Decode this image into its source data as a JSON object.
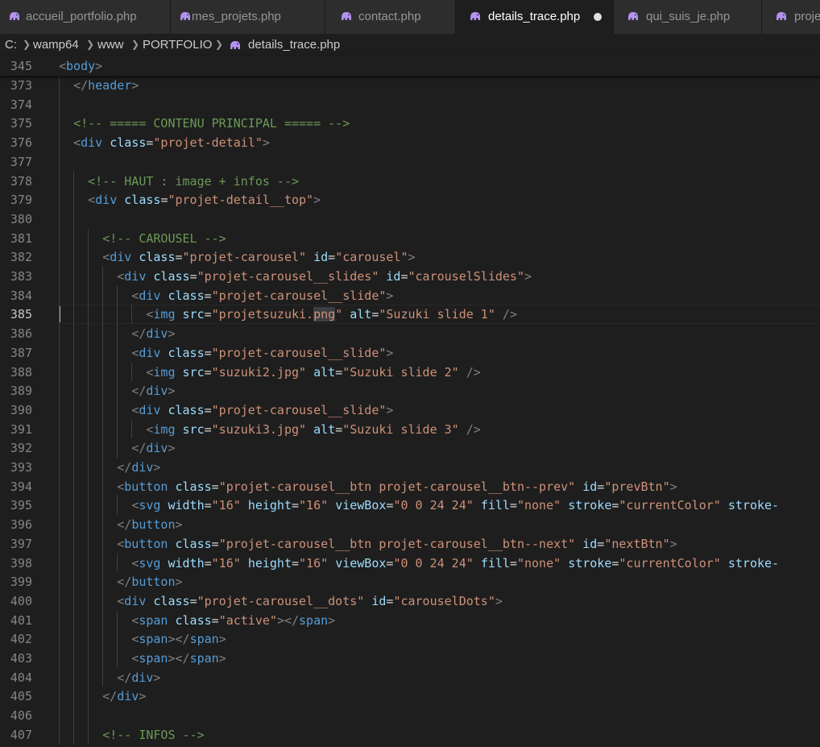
{
  "tabs": [
    {
      "label": "accueil_portfolio.php",
      "icon": "php-elephant-icon",
      "active": false
    },
    {
      "label": "mes_projets.php",
      "icon": "php-elephant-icon",
      "active": false
    },
    {
      "label": "contact.php",
      "icon": "php-elephant-icon",
      "active": false
    },
    {
      "label": "details_trace.php",
      "icon": "php-elephant-icon",
      "active": true,
      "dirty": true
    },
    {
      "label": "qui_suis_je.php",
      "icon": "php-elephant-icon",
      "active": false
    },
    {
      "label": "proje",
      "icon": "php-elephant-icon",
      "active": false
    }
  ],
  "breadcrumb": [
    "C:",
    "wamp64",
    "www",
    "PORTFOLIO",
    "details_trace.php"
  ],
  "sticky_line": {
    "number": "345",
    "code": "<body>"
  },
  "current_line": "385",
  "lines": [
    {
      "n": "373",
      "code": "  </header>"
    },
    {
      "n": "374",
      "code": ""
    },
    {
      "n": "375",
      "code": "  <!-- ===== CONTENU PRINCIPAL ===== -->"
    },
    {
      "n": "376",
      "code": "  <div class=\"projet-detail\">"
    },
    {
      "n": "377",
      "code": ""
    },
    {
      "n": "378",
      "code": "    <!-- HAUT : image + infos -->"
    },
    {
      "n": "379",
      "code": "    <div class=\"projet-detail__top\">"
    },
    {
      "n": "380",
      "code": ""
    },
    {
      "n": "381",
      "code": "      <!-- CAROUSEL -->"
    },
    {
      "n": "382",
      "code": "      <div class=\"projet-carousel\" id=\"carousel\">"
    },
    {
      "n": "383",
      "code": "        <div class=\"projet-carousel__slides\" id=\"carouselSlides\">"
    },
    {
      "n": "384",
      "code": "          <div class=\"projet-carousel__slide\">"
    },
    {
      "n": "385",
      "code": "            <img src=\"projetsuzuki.png\" alt=\"Suzuki slide 1\" />"
    },
    {
      "n": "386",
      "code": "          </div>"
    },
    {
      "n": "387",
      "code": "          <div class=\"projet-carousel__slide\">"
    },
    {
      "n": "388",
      "code": "            <img src=\"suzuki2.jpg\" alt=\"Suzuki slide 2\" />"
    },
    {
      "n": "389",
      "code": "          </div>"
    },
    {
      "n": "390",
      "code": "          <div class=\"projet-carousel__slide\">"
    },
    {
      "n": "391",
      "code": "            <img src=\"suzuki3.jpg\" alt=\"Suzuki slide 3\" />"
    },
    {
      "n": "392",
      "code": "          </div>"
    },
    {
      "n": "393",
      "code": "        </div>"
    },
    {
      "n": "394",
      "code": "        <button class=\"projet-carousel__btn projet-carousel__btn--prev\" id=\"prevBtn\">"
    },
    {
      "n": "395",
      "code": "          <svg width=\"16\" height=\"16\" viewBox=\"0 0 24 24\" fill=\"none\" stroke=\"currentColor\" stroke-"
    },
    {
      "n": "396",
      "code": "        </button>"
    },
    {
      "n": "397",
      "code": "        <button class=\"projet-carousel__btn projet-carousel__btn--next\" id=\"nextBtn\">"
    },
    {
      "n": "398",
      "code": "          <svg width=\"16\" height=\"16\" viewBox=\"0 0 24 24\" fill=\"none\" stroke=\"currentColor\" stroke-"
    },
    {
      "n": "399",
      "code": "        </button>"
    },
    {
      "n": "400",
      "code": "        <div class=\"projet-carousel__dots\" id=\"carouselDots\">"
    },
    {
      "n": "401",
      "code": "          <span class=\"active\"></span>"
    },
    {
      "n": "402",
      "code": "          <span></span>"
    },
    {
      "n": "403",
      "code": "          <span></span>"
    },
    {
      "n": "404",
      "code": "        </div>"
    },
    {
      "n": "405",
      "code": "      </div>"
    },
    {
      "n": "406",
      "code": ""
    },
    {
      "n": "407",
      "code": "      <!-- INFOS -->"
    }
  ],
  "selection": "png",
  "colors": {
    "background": "#1e1e1e",
    "tag": "#569cd6",
    "attribute": "#9cdcfe",
    "string": "#ce9178",
    "comment": "#6a9955",
    "php_icon": "#b392f0"
  }
}
